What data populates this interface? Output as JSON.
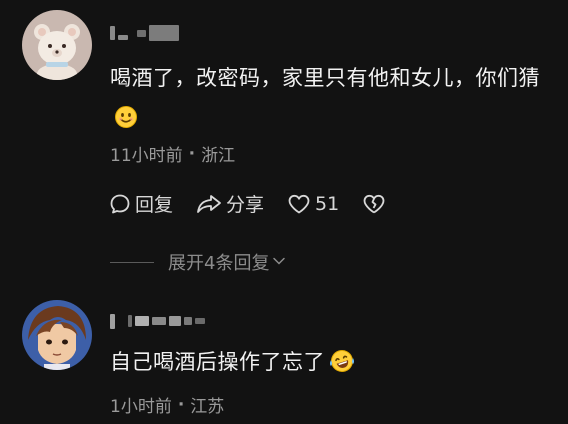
{
  "comments": [
    {
      "text": "喝酒了，改密码，家里只有他和女儿，你们猜",
      "emoji": "smiling-face-emoji",
      "time": "11小时前",
      "location": "浙江",
      "actions": {
        "reply_label": "回复",
        "share_label": "分享",
        "like_count": "51"
      },
      "expand_replies_label": "展开4条回复"
    },
    {
      "text": "自己喝酒后操作了忘了",
      "emoji": "laughing-tears-emoji",
      "time": "1小时前",
      "location": "江苏"
    }
  ],
  "separator": "·"
}
